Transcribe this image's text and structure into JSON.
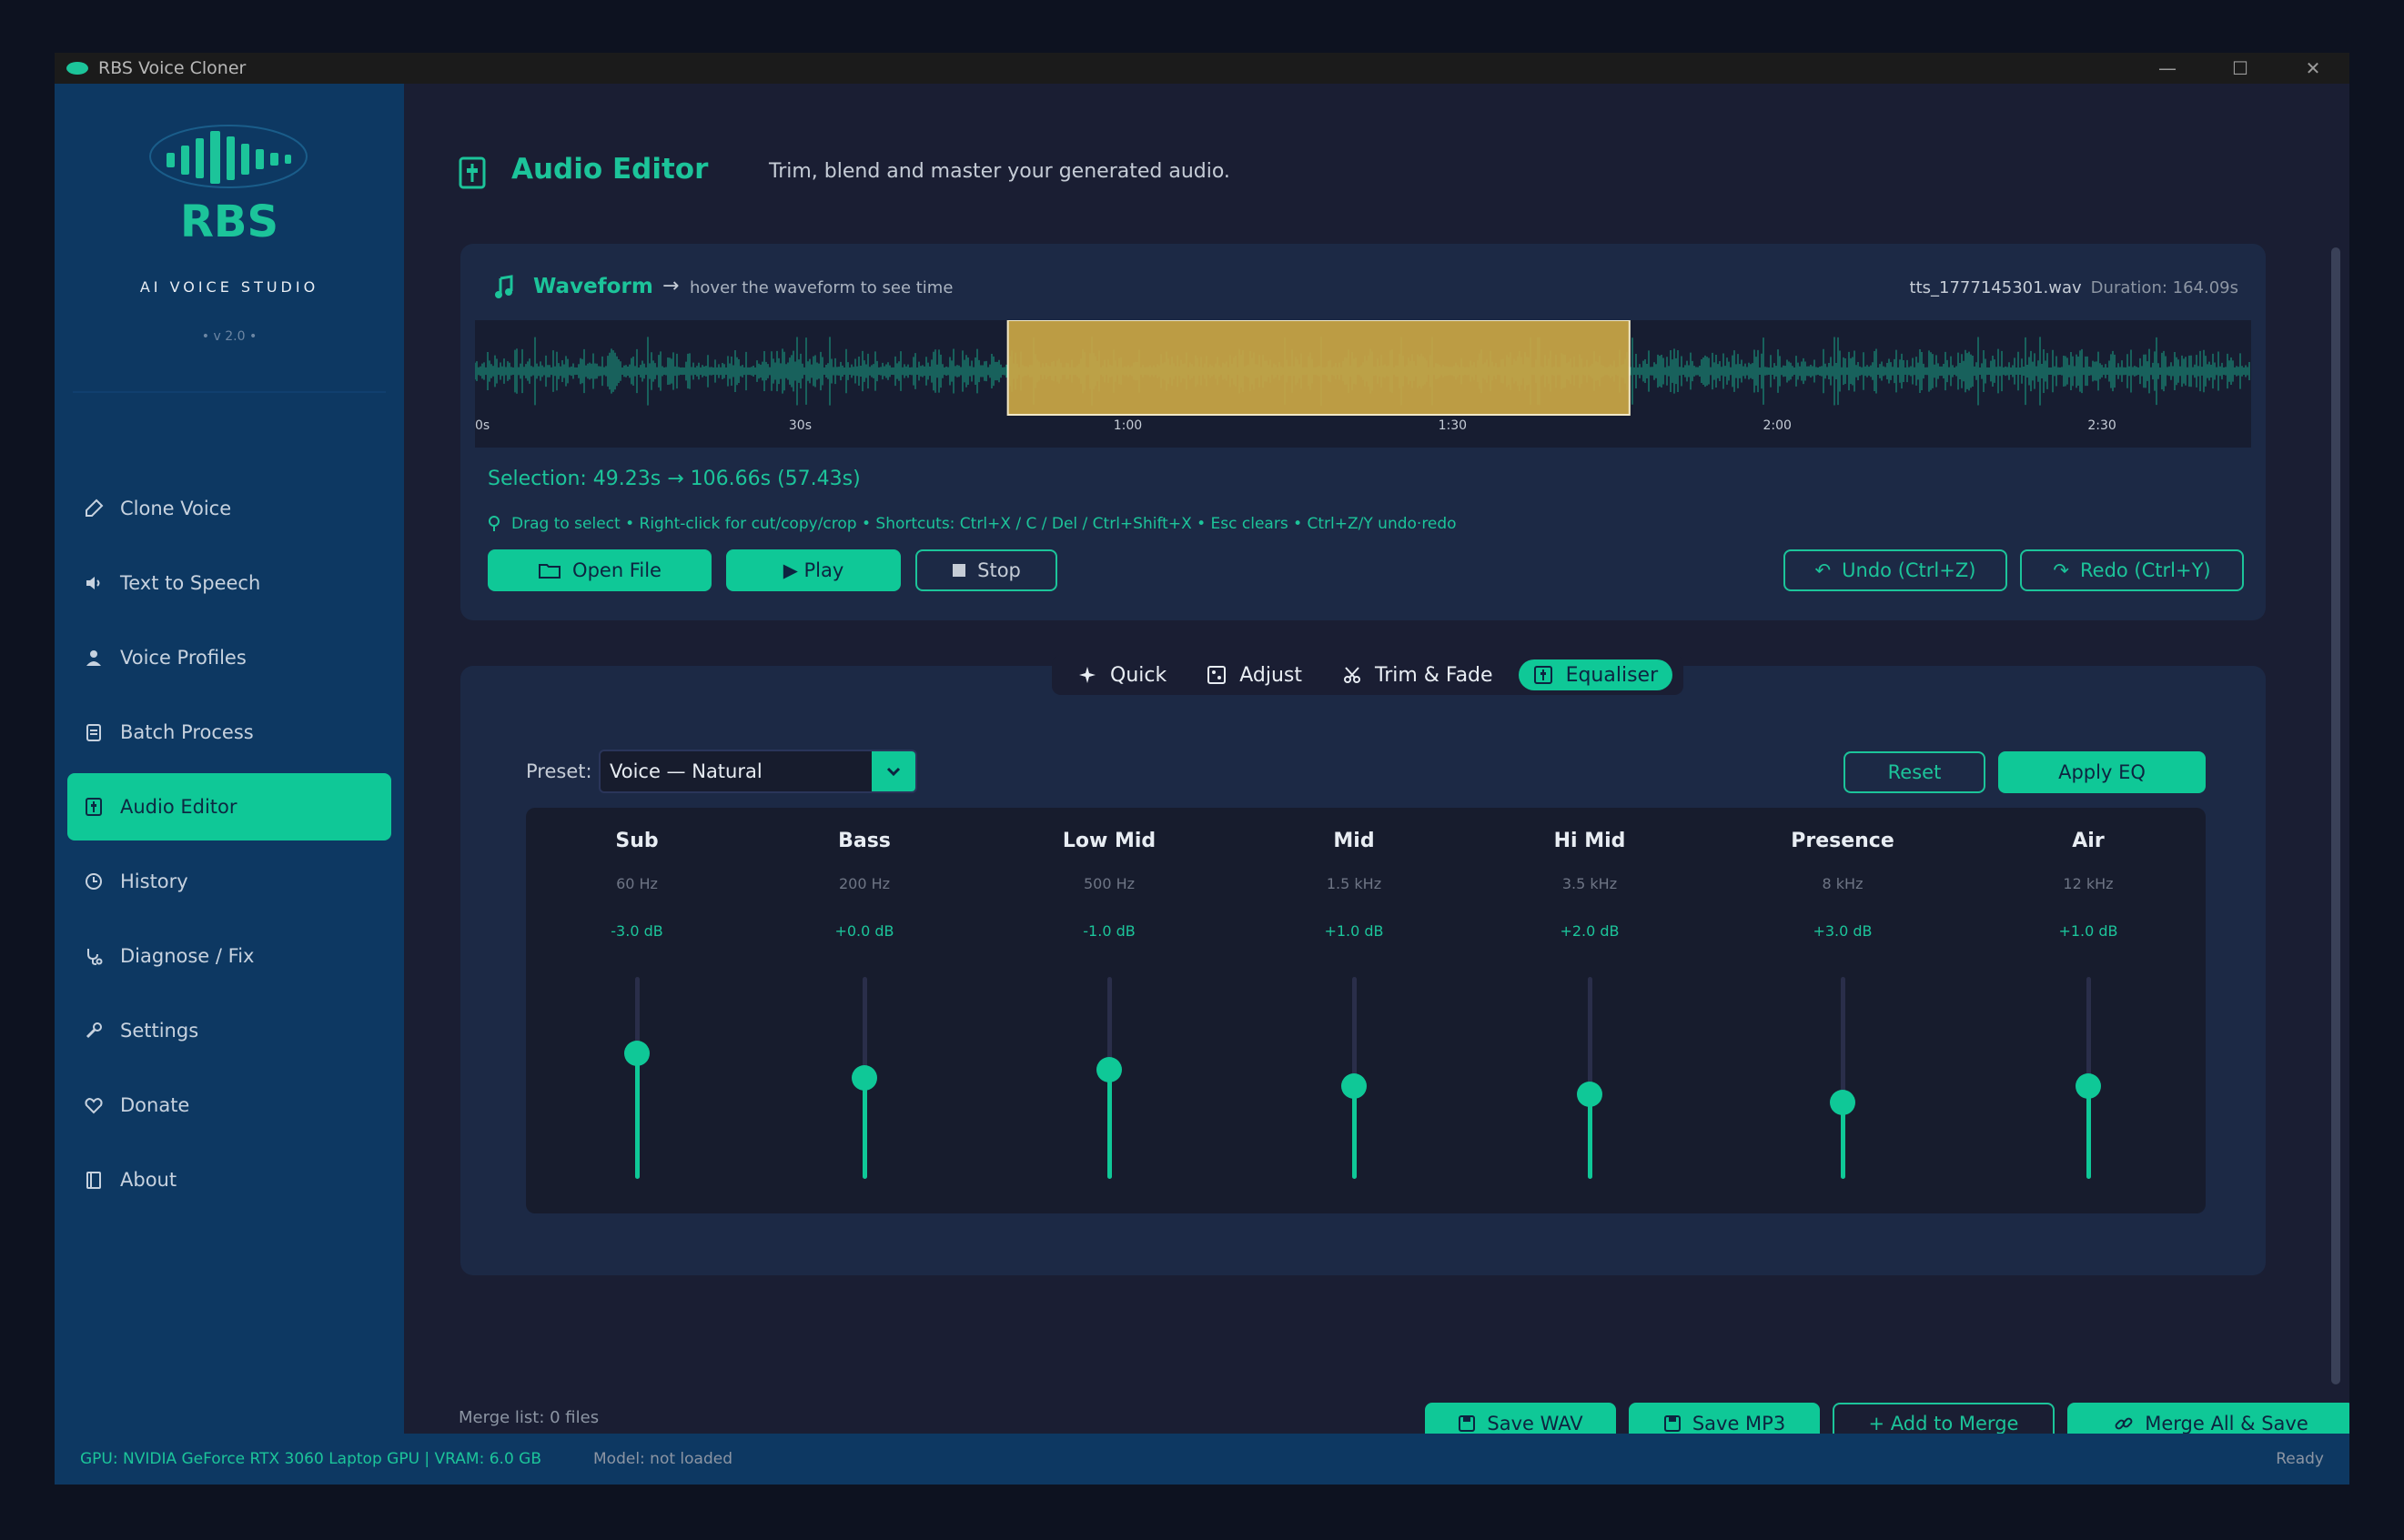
{
  "window": {
    "title": "RBS Voice Cloner"
  },
  "logo": {
    "text": "RBS",
    "subtitle": "AI VOICE STUDIO",
    "version": "• v 2.0 •"
  },
  "sidebar": {
    "items": [
      {
        "label": "Clone Voice",
        "icon": "microphone-icon"
      },
      {
        "label": "Text to Speech",
        "icon": "speaker-icon"
      },
      {
        "label": "Voice Profiles",
        "icon": "user-icon"
      },
      {
        "label": "Batch Process",
        "icon": "clipboard-icon"
      },
      {
        "label": "Audio Editor",
        "icon": "sliders-icon",
        "active": true
      },
      {
        "label": "History",
        "icon": "clock-icon"
      },
      {
        "label": "Diagnose / Fix",
        "icon": "stethoscope-icon"
      },
      {
        "label": "Settings",
        "icon": "wrench-icon"
      },
      {
        "label": "Donate",
        "icon": "heart-icon"
      },
      {
        "label": "About",
        "icon": "book-icon"
      }
    ]
  },
  "header": {
    "title": "Audio Editor",
    "subtitle": "Trim, blend and master your generated audio."
  },
  "waveform": {
    "title": "Waveform",
    "arrow": "→",
    "hint": "hover the waveform to see time",
    "file": "tts_1777145301.wav",
    "duration": "Duration: 164.09s",
    "ticks": [
      "0s",
      "30s",
      "1:00",
      "1:30",
      "2:00",
      "2:30"
    ],
    "selection_start_s": 49.23,
    "selection_end_s": 106.66,
    "total_s": 164.09
  },
  "selection": {
    "text": "Selection:  49.23s → 106.66s   (57.43s)"
  },
  "tips": "Drag to select • Right-click for cut/copy/crop • Shortcuts: Ctrl+X / C / Del / Ctrl+Shift+X • Esc clears • Ctrl+Z/Y undo·redo",
  "buttons": {
    "open": "Open File",
    "play": "▶ Play",
    "stop": "Stop",
    "undo": "Undo (Ctrl+Z)",
    "redo": "Redo (Ctrl+Y)",
    "reset": "Reset",
    "apply": "Apply EQ",
    "save_wav": "Save WAV",
    "save_mp3": "Save MP3",
    "add_merge": "+ Add to Merge",
    "merge_all": "Merge All & Save"
  },
  "tabs": [
    {
      "label": "Quick",
      "icon": "sparkle-icon"
    },
    {
      "label": "Adjust",
      "icon": "adjust-icon"
    },
    {
      "label": "Trim & Fade",
      "icon": "scissors-icon"
    },
    {
      "label": "Equaliser",
      "icon": "equaliser-icon",
      "active": true
    }
  ],
  "eq": {
    "preset_label": "Preset:",
    "preset_value": "Voice — Natural",
    "bands": [
      {
        "name": "Sub",
        "freq": "60 Hz",
        "gain": "-3.0 dB",
        "level": 0.62
      },
      {
        "name": "Bass",
        "freq": "200 Hz",
        "gain": "+0.0 dB",
        "level": 0.5
      },
      {
        "name": "Low Mid",
        "freq": "500 Hz",
        "gain": "-1.0 dB",
        "level": 0.54
      },
      {
        "name": "Mid",
        "freq": "1.5 kHz",
        "gain": "+1.0 dB",
        "level": 0.46
      },
      {
        "name": "Hi Mid",
        "freq": "3.5 kHz",
        "gain": "+2.0 dB",
        "level": 0.42
      },
      {
        "name": "Presence",
        "freq": "8 kHz",
        "gain": "+3.0 dB",
        "level": 0.38
      },
      {
        "name": "Air",
        "freq": "12 kHz",
        "gain": "+1.0 dB",
        "level": 0.46
      }
    ]
  },
  "merge": {
    "label": "Merge list: 0 files"
  },
  "status": {
    "gpu": "GPU: NVIDIA GeForce RTX 3060 Laptop GPU  |  VRAM: 6.0 GB",
    "model": "Model: not loaded",
    "state": "Ready"
  },
  "colors": {
    "accent": "#0fc897",
    "sidebar": "#0d3862",
    "selection": "#c9a646"
  }
}
